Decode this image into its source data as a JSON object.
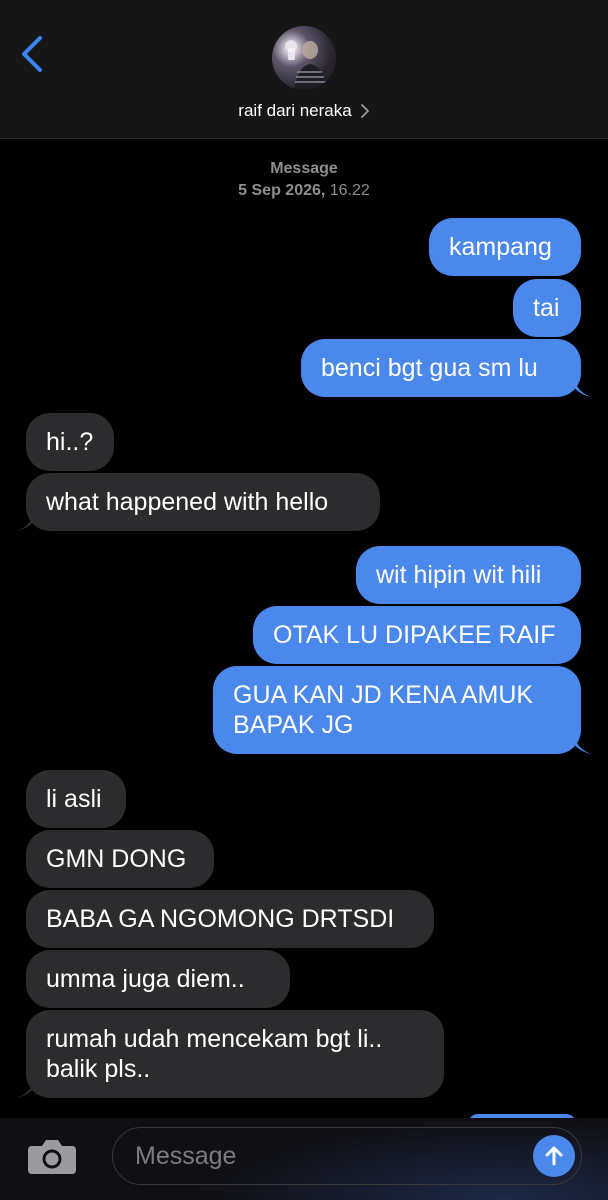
{
  "header": {
    "back_icon": "chevron-left-icon",
    "contact_name": "raif dari neraka",
    "chevron_icon": "chevron-right-icon",
    "accent": "#3b82f6"
  },
  "thread": {
    "label": "Message",
    "date": "5 Sep 2026,",
    "time": "16.22",
    "messages": [
      {
        "from": "me",
        "text": "kampang"
      },
      {
        "from": "me",
        "text": "tai"
      },
      {
        "from": "me",
        "text": "benci bgt gua sm lu"
      },
      {
        "from": "them",
        "text": "hi..?"
      },
      {
        "from": "them",
        "text": "what happened with hello"
      },
      {
        "from": "me",
        "text": "wit hipin wit hili"
      },
      {
        "from": "me",
        "text": "OTAK LU DIPAKEE RAIF"
      },
      {
        "from": "me",
        "text": "GUA KAN JD KENA AMUK\nBAPAK JG"
      },
      {
        "from": "them",
        "text": "li asli"
      },
      {
        "from": "them",
        "text": "GMN DONG"
      },
      {
        "from": "them",
        "text": "BABA GA NGOMONG DRTSDI"
      },
      {
        "from": "them",
        "text": "umma juga diem.."
      },
      {
        "from": "them",
        "text": "rumah udah mencekam bgt li..\nbalik pls.."
      }
    ]
  },
  "composer": {
    "camera_icon": "camera-icon",
    "placeholder": "Message",
    "send_icon": "arrow-up-icon"
  },
  "colors": {
    "sent_bubble": "#4a88ec",
    "received_bubble": "#2c2c2e",
    "background": "#000000"
  }
}
